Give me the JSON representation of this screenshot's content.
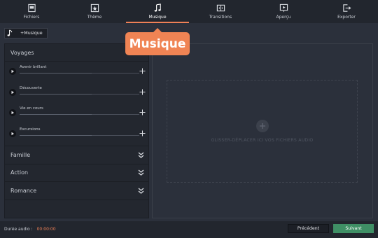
{
  "nav": {
    "items": [
      {
        "label": "Fichiers",
        "icon": "file-icon"
      },
      {
        "label": "Thème",
        "icon": "theme-icon"
      },
      {
        "label": "Musique",
        "icon": "music-note-icon",
        "active": true
      },
      {
        "label": "Transitions",
        "icon": "transitions-icon"
      },
      {
        "label": "Aperçu",
        "icon": "preview-icon"
      },
      {
        "label": "Exporter",
        "icon": "export-icon"
      }
    ]
  },
  "toolbar": {
    "add_music_label": "+Musique"
  },
  "tooltip": {
    "text": "Musique"
  },
  "library": {
    "open_category": "Voyages",
    "tracks": [
      "Avenir brillant",
      "Découverte",
      "Vie en cours",
      "Excursions"
    ],
    "collapsed_categories": [
      "Famille",
      "Action",
      "Romance"
    ]
  },
  "drop_zone": {
    "text": "GLISSER-DÉPLACER ICI VOS FICHIERS AUDIO"
  },
  "footer": {
    "duration_label": "Durée audio :",
    "duration_value": "00:00:00",
    "prev_label": "Précédent",
    "next_label": "Suivant"
  },
  "colors": {
    "accent": "#ef8056",
    "next_button": "#3f8f65",
    "background": "#2b303b"
  }
}
